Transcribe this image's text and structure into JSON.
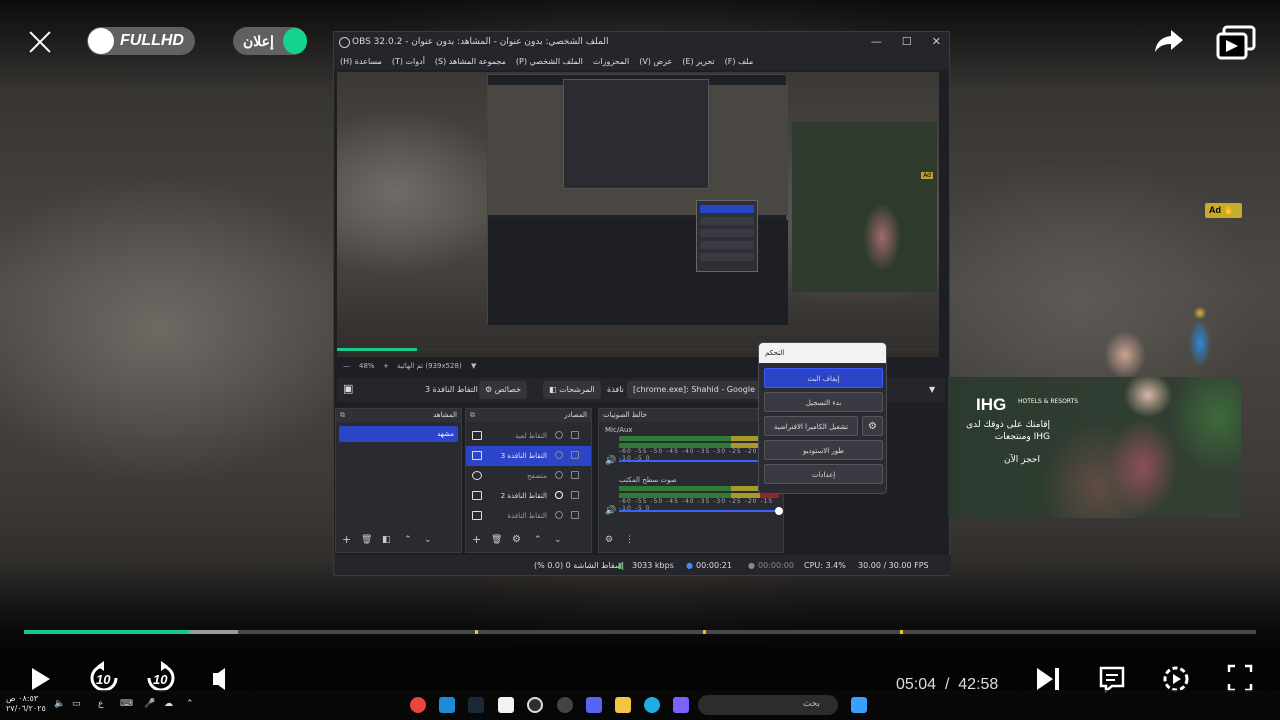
{
  "player": {
    "quality_label": "FULLHD",
    "ad_label": "إعلان",
    "elapsed": "05:04",
    "separator": "/",
    "duration": "42:58",
    "skip_back_seconds": "10",
    "skip_forward_seconds": "10",
    "progress_fraction": 0.134,
    "buffered_fraction": 0.134,
    "accent_color": "#16c98a"
  },
  "obs": {
    "title": "OBS 32.0.2 - الملف الشخصي: بدون عنوان - المشاهد: بدون عنوان",
    "menu": [
      "ملف (F)",
      "تحرير (E)",
      "عرض (V)",
      "المحزوزات",
      "الملف الشخصي (P)",
      "مجموعة المشاهد (S)",
      "أدوات (T)",
      "مساعدة (H)"
    ],
    "zoom": "48%",
    "canvas": "تم الهائية (939x528)",
    "context": {
      "source_name": "[chrome.exe]: Shahid - Google Ch",
      "window_label": "نافذة",
      "filters": "المرشحات",
      "properties": "خصائص",
      "selected": "التقاط النافذة 3"
    },
    "docks": {
      "scenes": "المشاهد",
      "sources": "المصادر",
      "mixer": "خالط الصوتيات"
    },
    "scenes": [
      "مشهد"
    ],
    "sources": [
      {
        "label": "التقاط لعبة",
        "selected": false
      },
      {
        "label": "التقاط النافذة 3",
        "selected": true
      },
      {
        "label": "متصفح",
        "selected": false
      },
      {
        "label": "التقاط النافذة 2",
        "selected": false
      },
      {
        "label": "التقاط النافذة",
        "selected": false
      }
    ],
    "mixer": [
      {
        "name": "Mic/Aux",
        "scale": "-60 -55 -50 -45 -40 -35 -30 -25 -20 -15 -10 -5 0"
      },
      {
        "name": "صوت سطح المكتب",
        "scale": "-60 -55 -50 -45 -40 -35 -30 -25 -20 -15 -10 -5 0"
      }
    ],
    "controls_popup": {
      "title": "التحكم",
      "buttons": [
        "إيقاف البث",
        "بدء التسجيل",
        "تشغيل الكاميرا الافتراضية",
        "طور الاستوديو",
        "إعدادات"
      ]
    },
    "status": {
      "dropped": "إسقاط الشاشة 0 (0.0 %)",
      "bitrate": "3033 kbps",
      "stream_time": "00:00:21",
      "record_time": "00:00:00",
      "cpu": "CPU: 3.4%",
      "fps": "30.00 / 30.00 FPS"
    }
  },
  "ad": {
    "badge": "Ad",
    "brand": "IHG",
    "brand_sub": "HOTELS & RESORTS",
    "text": "إقامتك على ذوقك لدى ومنتجعات IHG",
    "cta": "احجز الآن"
  },
  "taskbar": {
    "search_placeholder": "بحث",
    "clock_time": "٠٨:٥٣ ص",
    "clock_date": "٢٧/٠٦/٢٠٢٥",
    "language": "ع"
  }
}
